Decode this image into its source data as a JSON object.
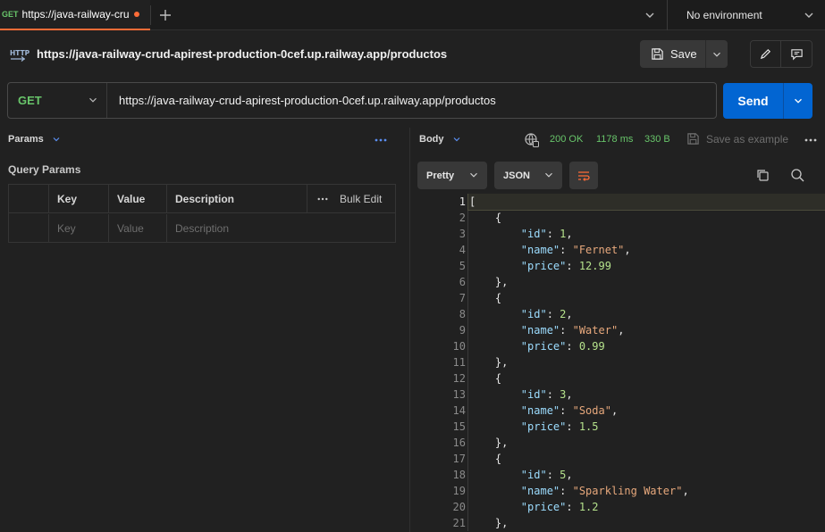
{
  "tabbar": {
    "active_tab": {
      "method": "GET",
      "title": "https://java-railway-cru",
      "unsaved": true
    },
    "environment": "No environment"
  },
  "request": {
    "name": "https://java-railway-crud-apirest-production-0cef.up.railway.app/productos",
    "save_label": "Save",
    "method": "GET",
    "url": "https://java-railway-crud-apirest-production-0cef.up.railway.app/productos",
    "send_label": "Send"
  },
  "params": {
    "tab_label": "Params",
    "section_title": "Query Params",
    "columns": {
      "key": "Key",
      "value": "Value",
      "description": "Description",
      "bulk_edit": "Bulk Edit"
    },
    "placeholders": {
      "key": "Key",
      "value": "Value",
      "description": "Description"
    }
  },
  "response": {
    "tab_label": "Body",
    "status": "200 OK",
    "time": "1178 ms",
    "size": "330 B",
    "save_example_label": "Save as example",
    "view_mode": "Pretty",
    "format": "JSON",
    "active_line": 1,
    "lines": [
      [
        {
          "t": "p",
          "v": "["
        }
      ],
      [
        {
          "t": "p",
          "v": "    {"
        }
      ],
      [
        {
          "t": "p",
          "v": "        "
        },
        {
          "t": "k",
          "v": "\"id\""
        },
        {
          "t": "p",
          "v": ": "
        },
        {
          "t": "n",
          "v": "1"
        },
        {
          "t": "p",
          "v": ","
        }
      ],
      [
        {
          "t": "p",
          "v": "        "
        },
        {
          "t": "k",
          "v": "\"name\""
        },
        {
          "t": "p",
          "v": ": "
        },
        {
          "t": "s",
          "v": "\"Fernet\""
        },
        {
          "t": "p",
          "v": ","
        }
      ],
      [
        {
          "t": "p",
          "v": "        "
        },
        {
          "t": "k",
          "v": "\"price\""
        },
        {
          "t": "p",
          "v": ": "
        },
        {
          "t": "n",
          "v": "12.99"
        }
      ],
      [
        {
          "t": "p",
          "v": "    },"
        }
      ],
      [
        {
          "t": "p",
          "v": "    {"
        }
      ],
      [
        {
          "t": "p",
          "v": "        "
        },
        {
          "t": "k",
          "v": "\"id\""
        },
        {
          "t": "p",
          "v": ": "
        },
        {
          "t": "n",
          "v": "2"
        },
        {
          "t": "p",
          "v": ","
        }
      ],
      [
        {
          "t": "p",
          "v": "        "
        },
        {
          "t": "k",
          "v": "\"name\""
        },
        {
          "t": "p",
          "v": ": "
        },
        {
          "t": "s",
          "v": "\"Water\""
        },
        {
          "t": "p",
          "v": ","
        }
      ],
      [
        {
          "t": "p",
          "v": "        "
        },
        {
          "t": "k",
          "v": "\"price\""
        },
        {
          "t": "p",
          "v": ": "
        },
        {
          "t": "n",
          "v": "0.99"
        }
      ],
      [
        {
          "t": "p",
          "v": "    },"
        }
      ],
      [
        {
          "t": "p",
          "v": "    {"
        }
      ],
      [
        {
          "t": "p",
          "v": "        "
        },
        {
          "t": "k",
          "v": "\"id\""
        },
        {
          "t": "p",
          "v": ": "
        },
        {
          "t": "n",
          "v": "3"
        },
        {
          "t": "p",
          "v": ","
        }
      ],
      [
        {
          "t": "p",
          "v": "        "
        },
        {
          "t": "k",
          "v": "\"name\""
        },
        {
          "t": "p",
          "v": ": "
        },
        {
          "t": "s",
          "v": "\"Soda\""
        },
        {
          "t": "p",
          "v": ","
        }
      ],
      [
        {
          "t": "p",
          "v": "        "
        },
        {
          "t": "k",
          "v": "\"price\""
        },
        {
          "t": "p",
          "v": ": "
        },
        {
          "t": "n",
          "v": "1.5"
        }
      ],
      [
        {
          "t": "p",
          "v": "    },"
        }
      ],
      [
        {
          "t": "p",
          "v": "    {"
        }
      ],
      [
        {
          "t": "p",
          "v": "        "
        },
        {
          "t": "k",
          "v": "\"id\""
        },
        {
          "t": "p",
          "v": ": "
        },
        {
          "t": "n",
          "v": "5"
        },
        {
          "t": "p",
          "v": ","
        }
      ],
      [
        {
          "t": "p",
          "v": "        "
        },
        {
          "t": "k",
          "v": "\"name\""
        },
        {
          "t": "p",
          "v": ": "
        },
        {
          "t": "s",
          "v": "\"Sparkling Water\""
        },
        {
          "t": "p",
          "v": ","
        }
      ],
      [
        {
          "t": "p",
          "v": "        "
        },
        {
          "t": "k",
          "v": "\"price\""
        },
        {
          "t": "p",
          "v": ": "
        },
        {
          "t": "n",
          "v": "1.2"
        }
      ],
      [
        {
          "t": "p",
          "v": "    },"
        }
      ]
    ]
  },
  "colors": {
    "accent_orange": "#ff6c37",
    "get_green": "#68c56a",
    "send_blue": "#0265d2",
    "json_key": "#9cdcfe",
    "json_string": "#e7a87c",
    "json_number": "#b5e28c"
  },
  "icons": [
    "plus-icon",
    "chevron-down-icon",
    "http-icon",
    "save-icon",
    "pencil-icon",
    "comment-icon",
    "more-horizontal-icon",
    "globe-icon",
    "save-example-icon",
    "wrap-lines-icon",
    "copy-icon",
    "search-icon"
  ]
}
